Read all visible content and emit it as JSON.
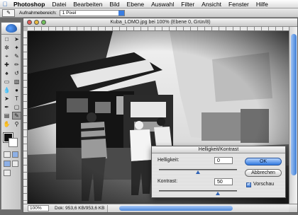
{
  "menubar": {
    "app_name": "Photoshop",
    "items": [
      "Datei",
      "Bearbeiten",
      "Bild",
      "Ebene",
      "Auswahl",
      "Filter",
      "Ansicht",
      "Fenster",
      "Hilfe"
    ]
  },
  "options": {
    "label": "Aufnahmebereich:",
    "value": "1 Pixel"
  },
  "document": {
    "title": "Kuba_LOMO.jpg bei 100% (Ebene 0, Grün/8)",
    "zoom": "100%",
    "doc_size": "Dok: 953,6 KB/953,6 KB"
  },
  "dialog": {
    "title": "Helligkeit/Kontrast",
    "brightness_label": "Helligkeit:",
    "brightness_value": "0",
    "contrast_label": "Kontrast:",
    "contrast_value": "50",
    "ok_label": "OK",
    "cancel_label": "Abbrechen",
    "preview_label": "Vorschau",
    "preview_checked": true
  },
  "colors": {
    "accent": "#3a7de0",
    "foreground": "#111111",
    "background": "#ffffff"
  }
}
